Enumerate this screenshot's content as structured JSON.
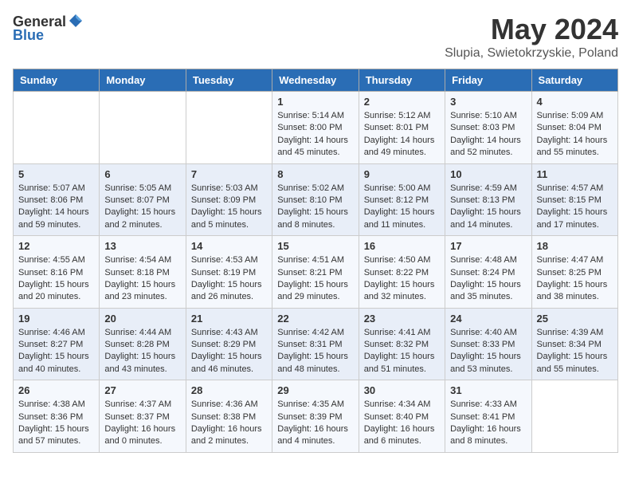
{
  "header": {
    "logo_general": "General",
    "logo_blue": "Blue",
    "month": "May 2024",
    "location": "Slupia, Swietokrzyskie, Poland"
  },
  "weekdays": [
    "Sunday",
    "Monday",
    "Tuesday",
    "Wednesday",
    "Thursday",
    "Friday",
    "Saturday"
  ],
  "weeks": [
    [
      {
        "day": "",
        "sunrise": "",
        "sunset": "",
        "daylight": ""
      },
      {
        "day": "",
        "sunrise": "",
        "sunset": "",
        "daylight": ""
      },
      {
        "day": "",
        "sunrise": "",
        "sunset": "",
        "daylight": ""
      },
      {
        "day": "1",
        "sunrise": "Sunrise: 5:14 AM",
        "sunset": "Sunset: 8:00 PM",
        "daylight": "Daylight: 14 hours and 45 minutes."
      },
      {
        "day": "2",
        "sunrise": "Sunrise: 5:12 AM",
        "sunset": "Sunset: 8:01 PM",
        "daylight": "Daylight: 14 hours and 49 minutes."
      },
      {
        "day": "3",
        "sunrise": "Sunrise: 5:10 AM",
        "sunset": "Sunset: 8:03 PM",
        "daylight": "Daylight: 14 hours and 52 minutes."
      },
      {
        "day": "4",
        "sunrise": "Sunrise: 5:09 AM",
        "sunset": "Sunset: 8:04 PM",
        "daylight": "Daylight: 14 hours and 55 minutes."
      }
    ],
    [
      {
        "day": "5",
        "sunrise": "Sunrise: 5:07 AM",
        "sunset": "Sunset: 8:06 PM",
        "daylight": "Daylight: 14 hours and 59 minutes."
      },
      {
        "day": "6",
        "sunrise": "Sunrise: 5:05 AM",
        "sunset": "Sunset: 8:07 PM",
        "daylight": "Daylight: 15 hours and 2 minutes."
      },
      {
        "day": "7",
        "sunrise": "Sunrise: 5:03 AM",
        "sunset": "Sunset: 8:09 PM",
        "daylight": "Daylight: 15 hours and 5 minutes."
      },
      {
        "day": "8",
        "sunrise": "Sunrise: 5:02 AM",
        "sunset": "Sunset: 8:10 PM",
        "daylight": "Daylight: 15 hours and 8 minutes."
      },
      {
        "day": "9",
        "sunrise": "Sunrise: 5:00 AM",
        "sunset": "Sunset: 8:12 PM",
        "daylight": "Daylight: 15 hours and 11 minutes."
      },
      {
        "day": "10",
        "sunrise": "Sunrise: 4:59 AM",
        "sunset": "Sunset: 8:13 PM",
        "daylight": "Daylight: 15 hours and 14 minutes."
      },
      {
        "day": "11",
        "sunrise": "Sunrise: 4:57 AM",
        "sunset": "Sunset: 8:15 PM",
        "daylight": "Daylight: 15 hours and 17 minutes."
      }
    ],
    [
      {
        "day": "12",
        "sunrise": "Sunrise: 4:55 AM",
        "sunset": "Sunset: 8:16 PM",
        "daylight": "Daylight: 15 hours and 20 minutes."
      },
      {
        "day": "13",
        "sunrise": "Sunrise: 4:54 AM",
        "sunset": "Sunset: 8:18 PM",
        "daylight": "Daylight: 15 hours and 23 minutes."
      },
      {
        "day": "14",
        "sunrise": "Sunrise: 4:53 AM",
        "sunset": "Sunset: 8:19 PM",
        "daylight": "Daylight: 15 hours and 26 minutes."
      },
      {
        "day": "15",
        "sunrise": "Sunrise: 4:51 AM",
        "sunset": "Sunset: 8:21 PM",
        "daylight": "Daylight: 15 hours and 29 minutes."
      },
      {
        "day": "16",
        "sunrise": "Sunrise: 4:50 AM",
        "sunset": "Sunset: 8:22 PM",
        "daylight": "Daylight: 15 hours and 32 minutes."
      },
      {
        "day": "17",
        "sunrise": "Sunrise: 4:48 AM",
        "sunset": "Sunset: 8:24 PM",
        "daylight": "Daylight: 15 hours and 35 minutes."
      },
      {
        "day": "18",
        "sunrise": "Sunrise: 4:47 AM",
        "sunset": "Sunset: 8:25 PM",
        "daylight": "Daylight: 15 hours and 38 minutes."
      }
    ],
    [
      {
        "day": "19",
        "sunrise": "Sunrise: 4:46 AM",
        "sunset": "Sunset: 8:27 PM",
        "daylight": "Daylight: 15 hours and 40 minutes."
      },
      {
        "day": "20",
        "sunrise": "Sunrise: 4:44 AM",
        "sunset": "Sunset: 8:28 PM",
        "daylight": "Daylight: 15 hours and 43 minutes."
      },
      {
        "day": "21",
        "sunrise": "Sunrise: 4:43 AM",
        "sunset": "Sunset: 8:29 PM",
        "daylight": "Daylight: 15 hours and 46 minutes."
      },
      {
        "day": "22",
        "sunrise": "Sunrise: 4:42 AM",
        "sunset": "Sunset: 8:31 PM",
        "daylight": "Daylight: 15 hours and 48 minutes."
      },
      {
        "day": "23",
        "sunrise": "Sunrise: 4:41 AM",
        "sunset": "Sunset: 8:32 PM",
        "daylight": "Daylight: 15 hours and 51 minutes."
      },
      {
        "day": "24",
        "sunrise": "Sunrise: 4:40 AM",
        "sunset": "Sunset: 8:33 PM",
        "daylight": "Daylight: 15 hours and 53 minutes."
      },
      {
        "day": "25",
        "sunrise": "Sunrise: 4:39 AM",
        "sunset": "Sunset: 8:34 PM",
        "daylight": "Daylight: 15 hours and 55 minutes."
      }
    ],
    [
      {
        "day": "26",
        "sunrise": "Sunrise: 4:38 AM",
        "sunset": "Sunset: 8:36 PM",
        "daylight": "Daylight: 15 hours and 57 minutes."
      },
      {
        "day": "27",
        "sunrise": "Sunrise: 4:37 AM",
        "sunset": "Sunset: 8:37 PM",
        "daylight": "Daylight: 16 hours and 0 minutes."
      },
      {
        "day": "28",
        "sunrise": "Sunrise: 4:36 AM",
        "sunset": "Sunset: 8:38 PM",
        "daylight": "Daylight: 16 hours and 2 minutes."
      },
      {
        "day": "29",
        "sunrise": "Sunrise: 4:35 AM",
        "sunset": "Sunset: 8:39 PM",
        "daylight": "Daylight: 16 hours and 4 minutes."
      },
      {
        "day": "30",
        "sunrise": "Sunrise: 4:34 AM",
        "sunset": "Sunset: 8:40 PM",
        "daylight": "Daylight: 16 hours and 6 minutes."
      },
      {
        "day": "31",
        "sunrise": "Sunrise: 4:33 AM",
        "sunset": "Sunset: 8:41 PM",
        "daylight": "Daylight: 16 hours and 8 minutes."
      },
      {
        "day": "",
        "sunrise": "",
        "sunset": "",
        "daylight": ""
      }
    ]
  ]
}
